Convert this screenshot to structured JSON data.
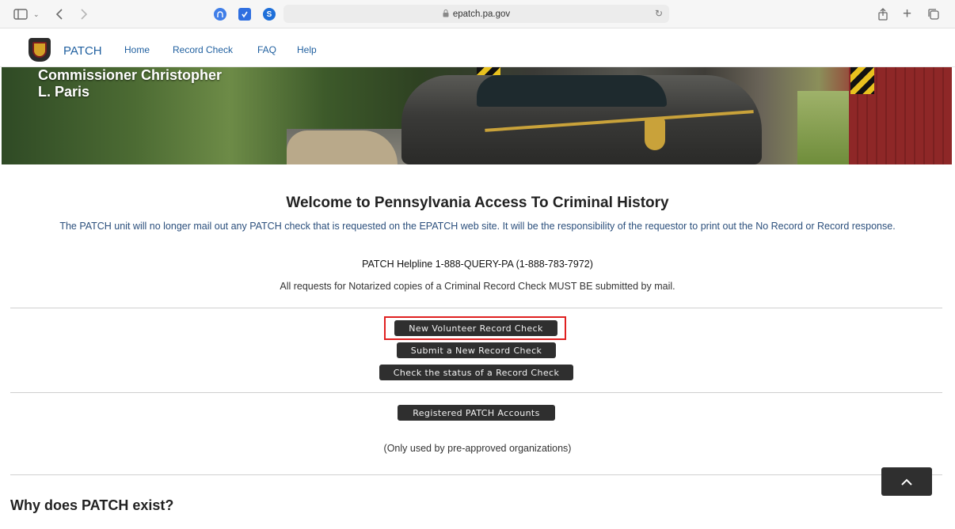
{
  "browser": {
    "url": "epatch.pa.gov",
    "icons": [
      "sidebar-icon",
      "chevron-down-icon",
      "back-icon",
      "forward-icon",
      "share-icon",
      "new-tab-icon",
      "tabs-icon",
      "reload-icon",
      "lock-icon"
    ],
    "extension_letter": "S"
  },
  "nav": {
    "brand": "PATCH",
    "links": [
      "Home",
      "Record Check",
      "FAQ",
      "Help"
    ]
  },
  "hero": {
    "title": "Commissioner Christopher\nL. Paris"
  },
  "main": {
    "welcome": "Welcome to Pennsylvania Access To Criminal History",
    "notice": "The PATCH unit will no longer mail out any PATCH check that is requested on the EPATCH web site. It will be the responsibility of the requestor to print out the No Record or Record response.",
    "helpline": "PATCH Helpline 1-888-QUERY-PA (1-888-783-7972)",
    "notarized": "All requests for Notarized copies of a Criminal Record Check MUST BE submitted by mail.",
    "buttons": {
      "volunteer": "New Volunteer Record Check",
      "submit": "Submit a New Record Check",
      "status": "Check the status of a Record Check",
      "registered": "Registered PATCH Accounts"
    },
    "preapproved": "(Only used by pre-approved organizations)",
    "why_heading": "Why does PATCH exist?"
  },
  "colors": {
    "link": "#1f5f9f",
    "notice_text": "#2b4f7c",
    "button_bg": "#2f2f2f",
    "highlight": "#e02020"
  }
}
